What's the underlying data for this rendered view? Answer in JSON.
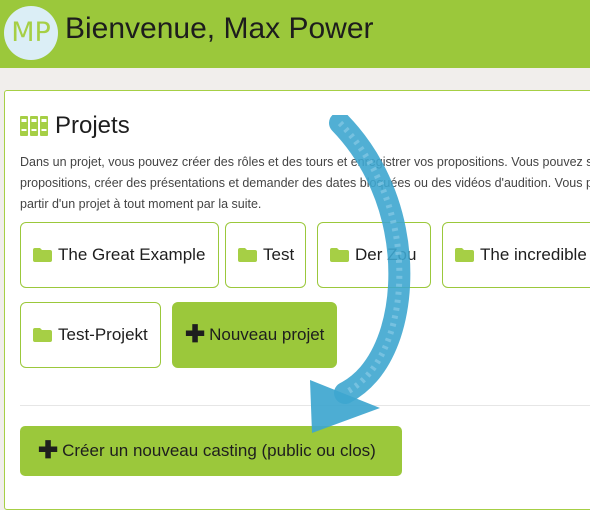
{
  "header": {
    "avatar_initials": "MP",
    "welcome": "Bienvenue, Max Power"
  },
  "projects": {
    "title": "Projets",
    "description_lines": [
      "Dans un projet, vous pouvez créer des rôles et des tours et enregistrer vos propositions. Vous pouvez s",
      "propositions, créer des présentations et demander des dates bloquées ou des vidéos d'audition. Vous po",
      "partir d'un projet à tout moment par la suite."
    ],
    "items": [
      {
        "label": "The Great Example"
      },
      {
        "label": "Test"
      },
      {
        "label": "Der Zou"
      },
      {
        "label": "The incredible"
      },
      {
        "label": "Test-Projekt"
      }
    ],
    "new_project_label": "Nouveau projet",
    "new_casting_label": "Créer un nouveau casting (public ou clos)"
  },
  "colors": {
    "brand_green": "#9bc83b",
    "folder_green": "#a6cf45",
    "arrow_blue": "#3ea6cf"
  }
}
